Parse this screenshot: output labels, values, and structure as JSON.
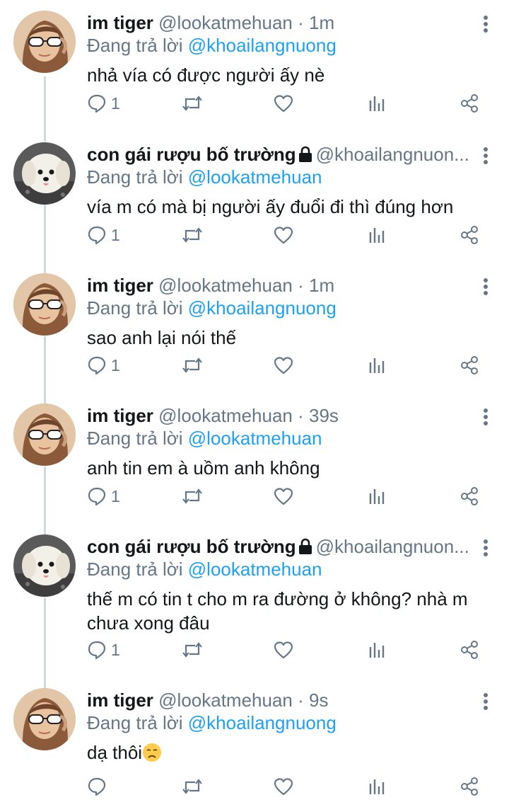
{
  "thread": {
    "tweets": [
      {
        "author_name": "im tiger",
        "handle": "@lookatmehuan",
        "dot": " · ",
        "time": "1m",
        "locked": false,
        "reply_prefix": "Đang trả lời ",
        "reply_to": "@khoailangnuong",
        "text": "nhả vía có được người ấy nè",
        "reply_count": "1",
        "avatar": "tiger-avatar"
      },
      {
        "author_name": "con gái rượu bố trường",
        "handle": "@khoailangnuon...",
        "dot": "",
        "time": "",
        "locked": true,
        "reply_prefix": "Đang trả lời ",
        "reply_to": "@lookatmehuan",
        "text": "vía m có mà bị người ấy đuổi đi thì đúng hơn",
        "reply_count": "1",
        "avatar": "dog-avatar"
      },
      {
        "author_name": "im tiger",
        "handle": "@lookatmehuan",
        "dot": " · ",
        "time": "1m",
        "locked": false,
        "reply_prefix": "Đang trả lời ",
        "reply_to": "@khoailangnuong",
        "text": "sao anh lại nói thế",
        "reply_count": "1",
        "avatar": "tiger-avatar"
      },
      {
        "author_name": "im tiger",
        "handle": "@lookatmehuan",
        "dot": " · ",
        "time": "39s",
        "locked": false,
        "reply_prefix": "Đang trả lời ",
        "reply_to": "@lookatmehuan",
        "text": "anh tin em à uồm anh không",
        "reply_count": "1",
        "avatar": "tiger-avatar"
      },
      {
        "author_name": "con gái rượu bố trường",
        "handle": "@khoailangnuon...",
        "dot": "",
        "time": "",
        "locked": true,
        "reply_prefix": "Đang trả lời ",
        "reply_to": "@lookatmehuan",
        "text": "thế m có tin t cho m ra đường ở không? nhà m chưa xong đâu",
        "reply_count": "1",
        "avatar": "dog-avatar"
      },
      {
        "author_name": "im tiger",
        "handle": "@lookatmehuan",
        "dot": " · ",
        "time": "9s",
        "locked": false,
        "reply_prefix": "Đang trả lời ",
        "reply_to": "@khoailangnuong",
        "text": "dạ thôi",
        "text_emoji": "disappointed-face-emoji",
        "reply_count": "",
        "avatar": "tiger-avatar"
      }
    ]
  },
  "icons": {
    "reply": "reply-icon",
    "retweet": "retweet-icon",
    "like": "like-icon",
    "analytics": "analytics-icon",
    "share": "share-icon",
    "more": "more-options-icon",
    "lock": "lock-icon"
  },
  "colors": {
    "text": "#14171a",
    "secondary": "#657786",
    "mention": "#1da1f2",
    "thread_line": "#cfd9de"
  }
}
